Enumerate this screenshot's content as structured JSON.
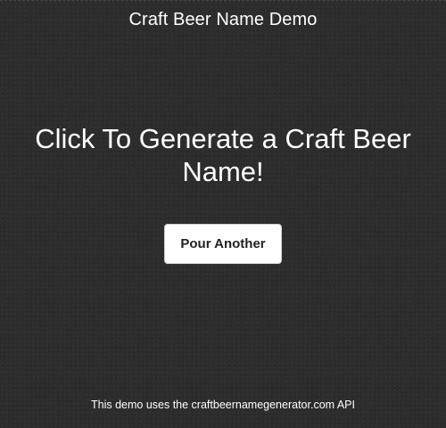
{
  "header": {
    "title": "Craft Beer Name Demo"
  },
  "main": {
    "headline": "Click To Generate a Craft Beer Name!",
    "button_label": "Pour Another"
  },
  "footer": {
    "note": "This demo uses the craftbeernamegenerator.com API"
  }
}
